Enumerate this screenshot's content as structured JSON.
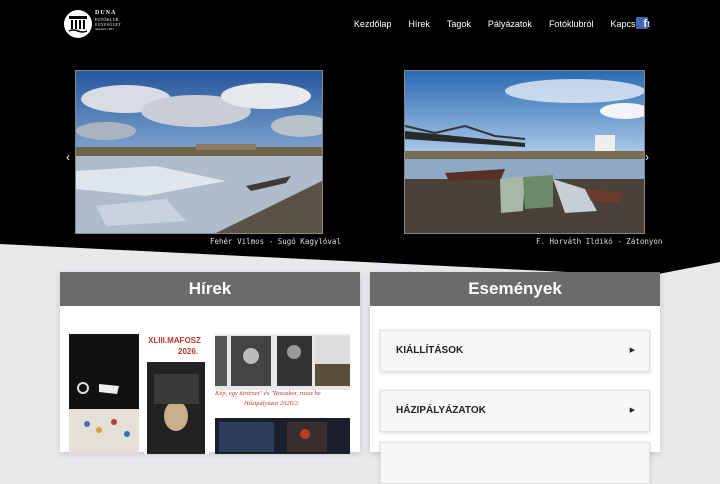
{
  "brand": {
    "line1": "DUNA",
    "line2": "FOTÓKLUB",
    "line3": "EGYESÜLET",
    "line4": "alapítva 1957"
  },
  "nav": {
    "items": [
      "Kezdőlap",
      "Hírek",
      "Tagok",
      "Pályázatok",
      "Fotóklubról",
      "Kapcsolat"
    ],
    "facebook_icon": "facebook-icon"
  },
  "slider": {
    "captions": [
      "Fehér Vilmos - Sugó Kagylóval",
      "F. Horváth Ildikó - Zátonyon"
    ],
    "prev_icon": "chevron-left-icon",
    "next_icon": "chevron-right-icon"
  },
  "news": {
    "title": "Hírek",
    "poster1_title": "XLIII.MAFOSZ",
    "poster1_year": "2026.",
    "poster2_text1": "Kép, egy történet\" és \"Rosszkor, rossz he",
    "poster2_text2": "Házipályázat 2026/2."
  },
  "events": {
    "title": "Események",
    "items": [
      "KIÁLLÍTÁSOK",
      "HÁZIPÁLYÁZATOK"
    ]
  },
  "colors": {
    "header_bg": "#000000",
    "card_header": "#6b6b6b",
    "facebook": "#4267b2",
    "poster_red": "#c0392b"
  }
}
